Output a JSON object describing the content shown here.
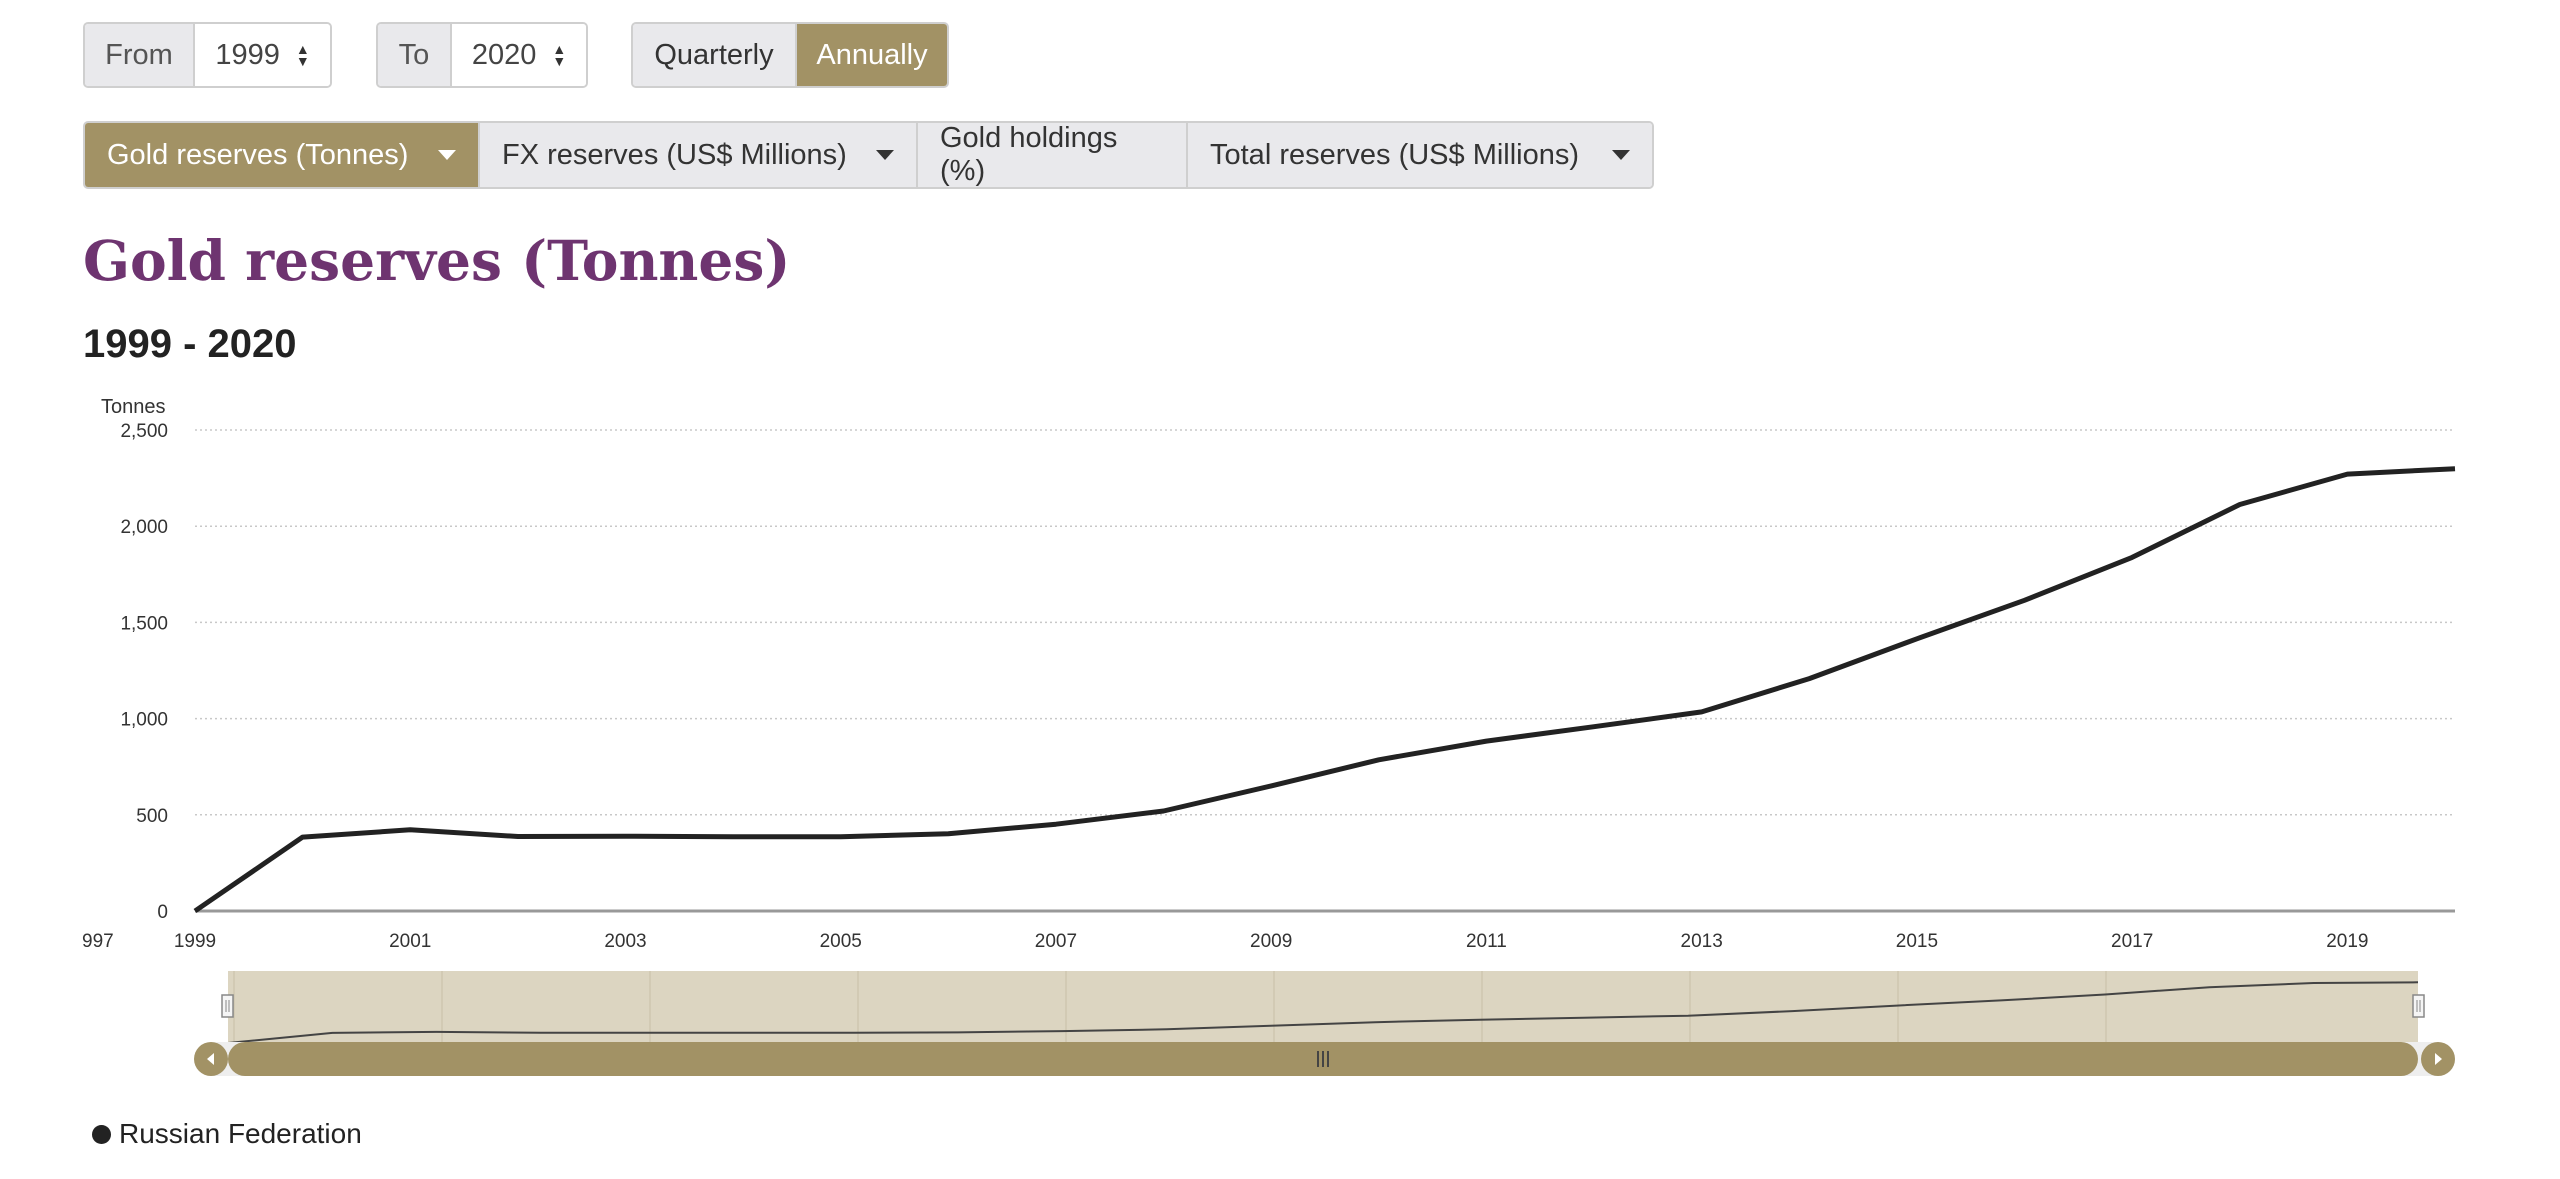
{
  "controls": {
    "from_label": "From",
    "from_value": "1999",
    "to_label": "To",
    "to_value": "2020",
    "frequency": [
      {
        "label": "Quarterly",
        "active": false
      },
      {
        "label": "Annually",
        "active": true
      }
    ]
  },
  "tabs": [
    {
      "label": "Gold reserves (Tonnes)",
      "active": true,
      "dropdown": true
    },
    {
      "label": "FX reserves (US$ Millions)",
      "active": false,
      "dropdown": true
    },
    {
      "label": "Gold holdings (%)",
      "active": false,
      "dropdown": false
    },
    {
      "label": "Total reserves (US$ Millions)",
      "active": false,
      "dropdown": true
    }
  ],
  "colors": {
    "accent": "#a29265",
    "title": "#6e3470",
    "line": "#222222",
    "navigator_bg": "#dcd5c1"
  },
  "chart_data": {
    "type": "line",
    "title": "Gold reserves (Tonnes)",
    "subtitle": "1999 - 2020",
    "ylabel": "Tonnes",
    "ylim": [
      0,
      2500
    ],
    "yticks": [
      "0",
      "500",
      "1,000",
      "1,500",
      "2,000",
      "2,500"
    ],
    "xticks": [
      "997",
      "1999",
      "2001",
      "2003",
      "2005",
      "2007",
      "2009",
      "2011",
      "2013",
      "2015",
      "2017",
      "2019"
    ],
    "grid": true,
    "series": [
      {
        "name": "Russian Federation",
        "x": [
          1999,
          2000,
          2001,
          2002,
          2003,
          2004,
          2005,
          2006,
          2007,
          2008,
          2009,
          2010,
          2011,
          2012,
          2013,
          2014,
          2015,
          2016,
          2017,
          2018,
          2019,
          2020
        ],
        "values": [
          0,
          384,
          422,
          387,
          389,
          386,
          386,
          402,
          451,
          520,
          650,
          786,
          883,
          958,
          1035,
          1208,
          1415,
          1615,
          1838,
          2113,
          2271,
          2299
        ]
      }
    ]
  },
  "legend": {
    "items": [
      "Russian Federation"
    ]
  }
}
